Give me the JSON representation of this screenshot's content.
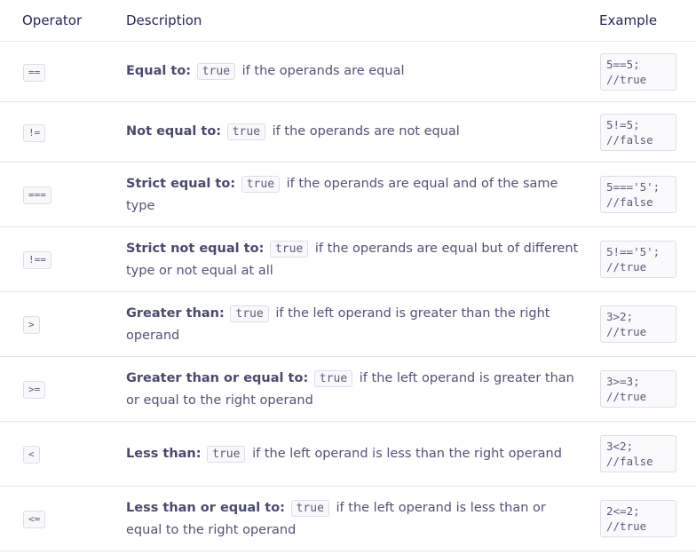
{
  "headers": {
    "operator": "Operator",
    "description": "Description",
    "example": "Example"
  },
  "rows": [
    {
      "operator": "==",
      "title": "Equal to:",
      "code": "true",
      "text": "if the operands are equal",
      "example": [
        "5==5;",
        "//true"
      ]
    },
    {
      "operator": "!=",
      "title": "Not equal to:",
      "code": "true",
      "text": "if the operands are not equal",
      "example": [
        "5!=5;",
        "//false"
      ]
    },
    {
      "operator": "===",
      "title": "Strict equal to:",
      "code": "true",
      "text": "if the operands are equal and of the same type",
      "example": [
        "5==='5';",
        "//false"
      ]
    },
    {
      "operator": "!==",
      "title": "Strict not equal to:",
      "code": "true",
      "text": "if the operands are equal but of different type or not equal at all",
      "example": [
        "5!=='5';",
        "//true"
      ]
    },
    {
      "operator": ">",
      "title": "Greater than:",
      "code": "true",
      "text": "if the left operand is greater than the right operand",
      "example": [
        "3>2;",
        "//true"
      ]
    },
    {
      "operator": ">=",
      "title": "Greater than or equal to:",
      "code": "true",
      "text": "if the left operand is greater than or equal to the right operand",
      "example": [
        "3>=3;",
        "//true"
      ]
    },
    {
      "operator": "<",
      "title": "Less than:",
      "code": "true",
      "text": "if the left operand is less than the right operand",
      "example": [
        "3<2;",
        "//false"
      ]
    },
    {
      "operator": "<=",
      "title": "Less than or equal to:",
      "code": "true",
      "text": "if the left operand is less than or equal to the right operand",
      "example": [
        "2<=2;",
        "//true"
      ]
    }
  ]
}
